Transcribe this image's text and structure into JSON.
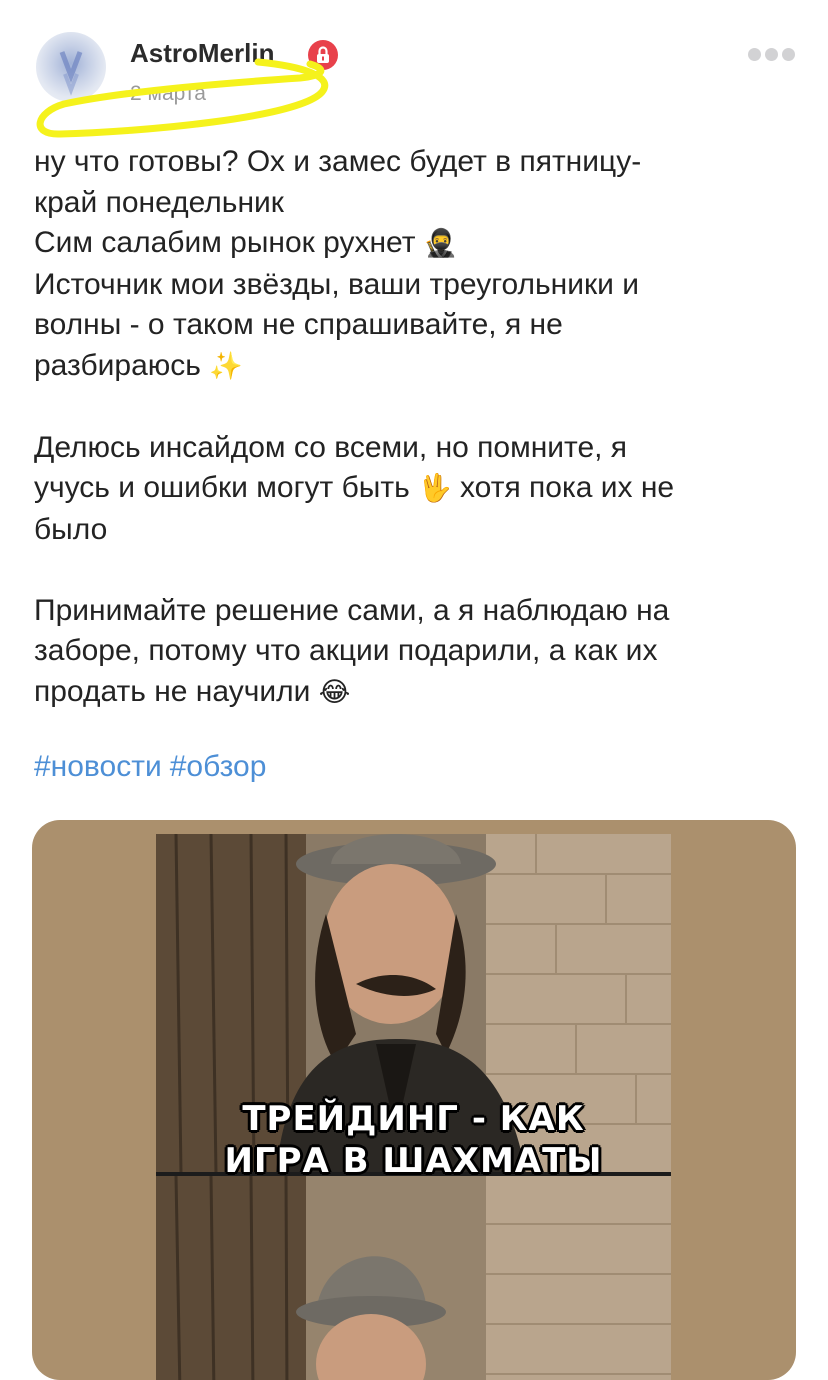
{
  "post": {
    "author": "AstroMerlin",
    "date": "2 марта",
    "paragraphs": [
      {
        "text": "ну что готовы? Ох и замес будет в пятницу-\nкрай понедельник\nСим салабим рынок рухнет",
        "emoji": "🥷"
      },
      {
        "text": "Источник мои звёзды, ваши треугольники и\nволны - о таком не спрашивайте, я не\nразбираюсь",
        "emoji": "✨"
      },
      {
        "text": "Делюсь инсайдом со всеми, но помните, я\nучусь и ошибки могут быть",
        "emoji": "🖖",
        "after": "хотя пока их не\nбыло"
      },
      {
        "text": "Принимайте решение сами, а я наблюдаю на\nзаборе, потому что акции подарили, а как их\nпродать не научили",
        "emoji": "😂"
      }
    ],
    "hashtags": [
      "#новости",
      "#обзор"
    ]
  },
  "media": {
    "caption_line1": "ТРЕЙДИНГ - КАК",
    "caption_line2": "ИГРА В ШАХМАТЫ"
  },
  "colors": {
    "hashtag": "#4d8fd6",
    "lock_badge": "#e8414b",
    "highlight": "#f5f21c",
    "media_bg": "#ab906d"
  },
  "icons": [
    "lock-icon",
    "more-icon"
  ]
}
